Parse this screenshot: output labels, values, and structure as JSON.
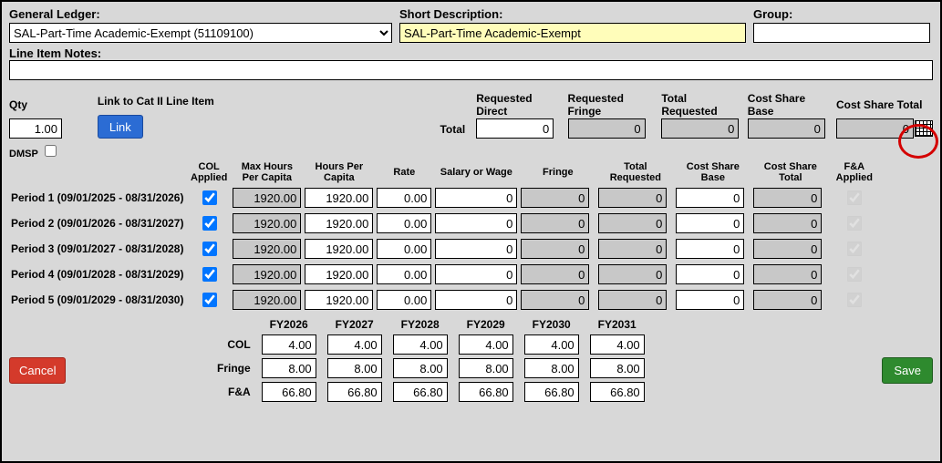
{
  "labels": {
    "general_ledger": "General Ledger:",
    "short_desc": "Short Description:",
    "group": "Group:",
    "line_item_notes": "Line Item Notes:",
    "qty": "Qty",
    "link_cat": "Link to Cat II Line Item",
    "link_btn": "Link",
    "dmsp": "DMSP",
    "requested_direct": "Requested Direct",
    "requested_fringe": "Requested Fringe",
    "total_requested": "Total Requested",
    "cost_share_base": "Cost Share Base",
    "cost_share_total": "Cost Share Total",
    "total": "Total",
    "cancel": "Cancel",
    "save": "Save"
  },
  "gl_value": "SAL-Part-Time Academic-Exempt (51109100)",
  "short_desc_value": "SAL-Part-Time Academic-Exempt",
  "group_value": "",
  "notes_value": "",
  "qty_value": "1.00",
  "dmsp_checked": false,
  "summary": {
    "requested_direct": "0",
    "requested_fringe": "0",
    "total_requested": "0",
    "cost_share_base": "0",
    "cost_share_total": "0"
  },
  "period_headers": {
    "col_applied": "COL Applied",
    "max_hours": "Max Hours Per Capita",
    "hours_per_capita": "Hours Per Capita",
    "rate": "Rate",
    "salary_wage": "Salary or Wage",
    "fringe": "Fringe",
    "total_requested": "Total Requested",
    "cost_share_base": "Cost Share Base",
    "cost_share_total": "Cost Share Total",
    "fa_applied": "F&A Applied"
  },
  "periods": [
    {
      "label": "Period 1 (09/01/2025 - 08/31/2026)",
      "col": true,
      "max": "1920.00",
      "hpc": "1920.00",
      "rate": "0.00",
      "sal": "0",
      "fringe": "0",
      "tot": "0",
      "csb": "0",
      "cst": "0",
      "fa": true
    },
    {
      "label": "Period 2 (09/01/2026 - 08/31/2027)",
      "col": true,
      "max": "1920.00",
      "hpc": "1920.00",
      "rate": "0.00",
      "sal": "0",
      "fringe": "0",
      "tot": "0",
      "csb": "0",
      "cst": "0",
      "fa": true
    },
    {
      "label": "Period 3 (09/01/2027 - 08/31/2028)",
      "col": true,
      "max": "1920.00",
      "hpc": "1920.00",
      "rate": "0.00",
      "sal": "0",
      "fringe": "0",
      "tot": "0",
      "csb": "0",
      "cst": "0",
      "fa": true
    },
    {
      "label": "Period 4 (09/01/2028 - 08/31/2029)",
      "col": true,
      "max": "1920.00",
      "hpc": "1920.00",
      "rate": "0.00",
      "sal": "0",
      "fringe": "0",
      "tot": "0",
      "csb": "0",
      "cst": "0",
      "fa": true
    },
    {
      "label": "Period 5 (09/01/2029 - 08/31/2030)",
      "col": true,
      "max": "1920.00",
      "hpc": "1920.00",
      "rate": "0.00",
      "sal": "0",
      "fringe": "0",
      "tot": "0",
      "csb": "0",
      "cst": "0",
      "fa": true
    }
  ],
  "fy_headers": [
    "FY2026",
    "FY2027",
    "FY2028",
    "FY2029",
    "FY2030",
    "FY2031"
  ],
  "fy_row_labels": {
    "col": "COL",
    "fringe": "Fringe",
    "fa": "F&A"
  },
  "fy_rows": {
    "col": [
      "4.00",
      "4.00",
      "4.00",
      "4.00",
      "4.00",
      "4.00"
    ],
    "fringe": [
      "8.00",
      "8.00",
      "8.00",
      "8.00",
      "8.00",
      "8.00"
    ],
    "fa": [
      "66.80",
      "66.80",
      "66.80",
      "66.80",
      "66.80",
      "66.80"
    ]
  }
}
